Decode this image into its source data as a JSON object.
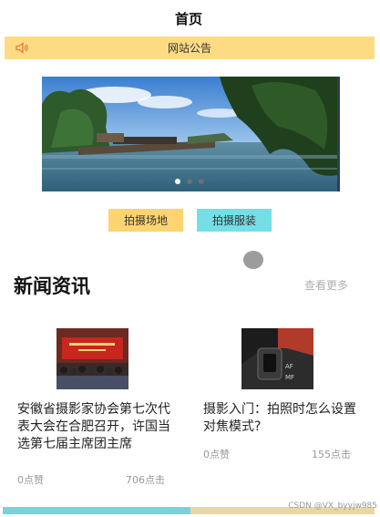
{
  "nav": {
    "title": "首页"
  },
  "notice": {
    "icon": "speaker-icon",
    "text": "网站公告"
  },
  "banner": {
    "slide_count": 3,
    "active_index": 0
  },
  "quick_buttons": [
    {
      "label": "拍摄场地",
      "color": "#fdd46f"
    },
    {
      "label": "拍摄服装",
      "color": "#74dfe6"
    }
  ],
  "news": {
    "title": "新闻资讯",
    "more": "查看更多",
    "items": [
      {
        "title": "安徽省摄影家协会第七次代表大会在合肥召开，许国当选第七届主席团主席",
        "likes": "0点赞",
        "clicks": "706点击"
      },
      {
        "title": "摄影入门：拍照时怎么设置对焦模式?",
        "likes": "0点赞",
        "clicks": "155点击"
      }
    ]
  },
  "watermark": "CSDN @VX_byyjw985"
}
